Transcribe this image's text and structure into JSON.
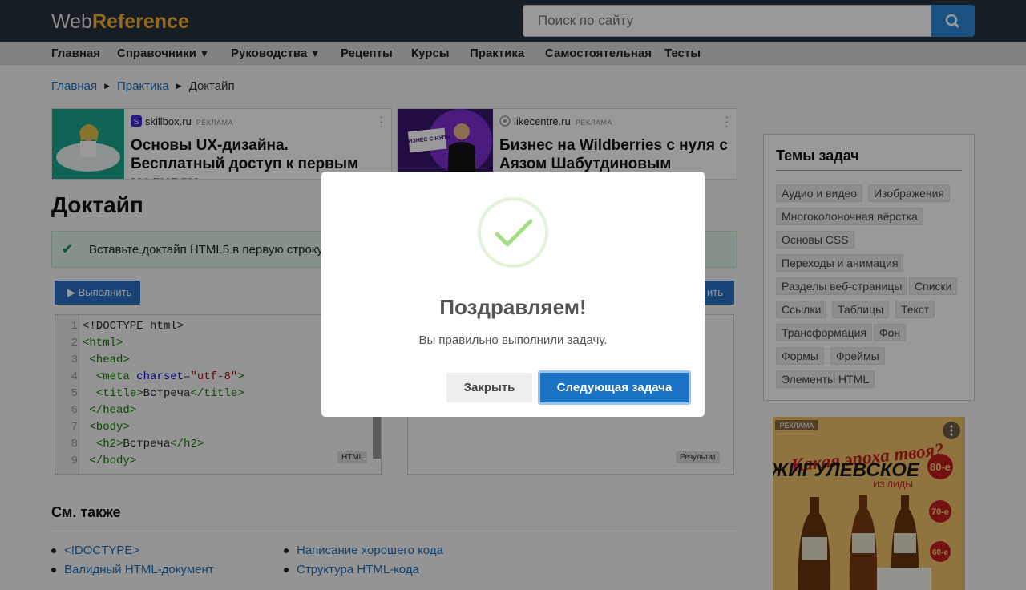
{
  "header": {
    "logo_part1": "Web",
    "logo_part2": "Reference",
    "search_placeholder": "Поиск по сайту"
  },
  "nav": {
    "items": [
      "Главная",
      "Справочники",
      "Руководства",
      "Рецепты",
      "Курсы",
      "Практика",
      "Самостоятельная",
      "Тесты"
    ],
    "dropdown_arrow": "▼"
  },
  "breadcrumb": {
    "items": [
      "Главная",
      "Практика",
      "Доктайп"
    ],
    "sep": "▶"
  },
  "ads": [
    {
      "site": "skillbox.ru",
      "tag": "РЕКЛАМА",
      "title": "Основы UX-дизайна. Бесплатный доступ к первым модулям."
    },
    {
      "site": "likecentre.ru",
      "tag": "РЕКЛАМА",
      "title": "Бизнес на Wildberries с нуля с Аязом Шабутдиновым",
      "image_text": "БИЗНЕС С НУЛЯ"
    }
  ],
  "page_title": "Доктайп",
  "task": {
    "text": "Вставьте доктайп HTML5 в первую строку",
    "check": "✔"
  },
  "editor": {
    "run_label": "▶ Выполнить",
    "run_label_right": "ить",
    "lang_badge": "HTML",
    "result_badge": "Результат",
    "line_numbers": [
      "1",
      "2",
      "3",
      "4",
      "5",
      "6",
      "7",
      "8",
      "9"
    ]
  },
  "see_also": {
    "title": "См. также",
    "links": [
      "<!DOCTYPE>",
      "Валидный HTML-документ",
      "Написание хорошего кода",
      "Структура HTML-кода"
    ]
  },
  "sidebar": {
    "title": "Темы задач",
    "tags": [
      "Аудио и видео",
      "Изображения",
      "Многоколоночная вёрстка",
      "Основы CSS",
      "Переходы и анимация",
      "Разделы веб-страницы",
      "Списки",
      "Ссылки",
      "Таблицы",
      "Текст",
      "Трансформация",
      "Фон",
      "Формы",
      "Фреймы",
      "Элементы HTML"
    ],
    "ad": {
      "tag": "РЕКЛАМА",
      "line1": "Какая эпоха твоя?",
      "line2": "ЖИГУЛЕВСКОЕ",
      "line3": "ИЗ ЛИДЫ",
      "eras": [
        "80-е",
        "70-е",
        "60-е"
      ]
    }
  },
  "modal": {
    "title": "Поздравляем!",
    "text": "Вы правильно выполнили задачу.",
    "close_label": "Закрыть",
    "next_label": "Следующая задача"
  },
  "colors": {
    "header_bg": "#25313d",
    "logo_accent": "#f3b233",
    "link": "#1e6fb8",
    "primary_button": "#1a73c5",
    "success_check": "#a5dc86"
  }
}
